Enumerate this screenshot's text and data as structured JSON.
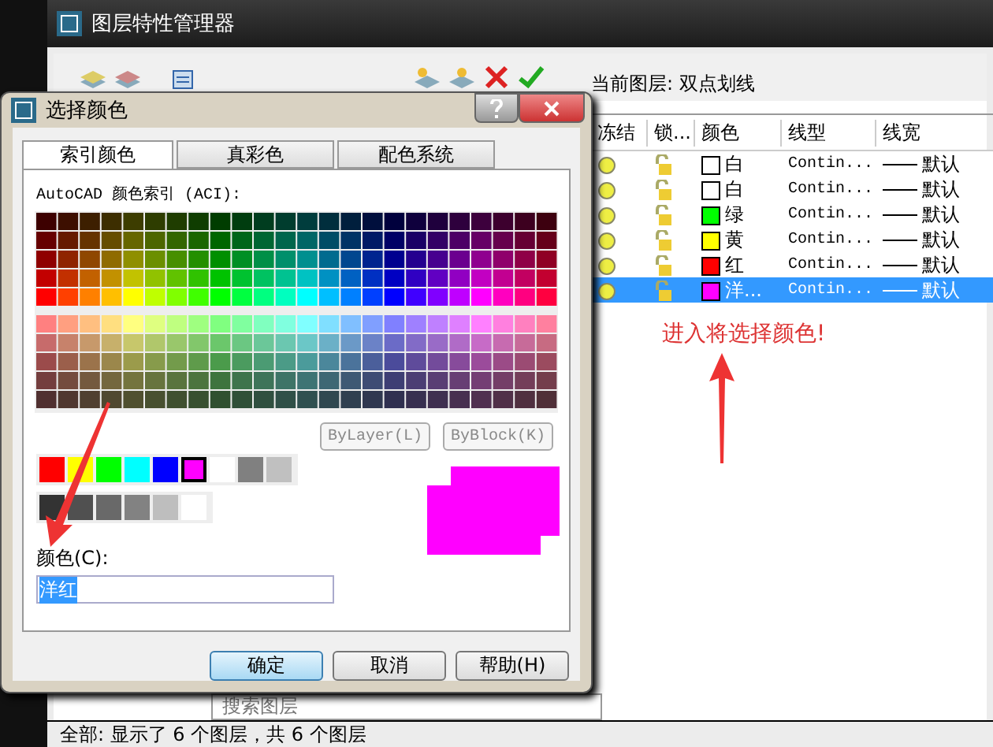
{
  "layer_manager": {
    "title": "图层特性管理器",
    "current_layer": "当前图层: 双点划线",
    "columns": [
      "冻结",
      "锁...",
      "颜色",
      "线型",
      "线宽"
    ],
    "rows": [
      {
        "color_name": "白",
        "color": "#ffffff",
        "linetype": "Contin...",
        "lineweight": "默认",
        "selected": false
      },
      {
        "color_name": "白",
        "color": "#ffffff",
        "linetype": "Contin...",
        "lineweight": "默认",
        "selected": false
      },
      {
        "color_name": "绿",
        "color": "#00ff00",
        "linetype": "Contin...",
        "lineweight": "默认",
        "selected": false
      },
      {
        "color_name": "黄",
        "color": "#ffff00",
        "linetype": "Contin...",
        "lineweight": "默认",
        "selected": false
      },
      {
        "color_name": "红",
        "color": "#ff0000",
        "linetype": "Contin...",
        "lineweight": "默认",
        "selected": false
      },
      {
        "color_name": "洋...",
        "color": "#ff00ff",
        "linetype": "Contin...",
        "lineweight": "默认",
        "selected": true
      }
    ],
    "search_placeholder": "搜索图层",
    "status": "全部: 显示了 6 个图层，共 6 个图层"
  },
  "dialog": {
    "title": "选择颜色",
    "tabs": [
      {
        "label": "索引颜色",
        "selected": true
      },
      {
        "label": "真彩色",
        "selected": false
      },
      {
        "label": "配色系统",
        "selected": false
      }
    ],
    "palette_label": "AutoCAD 颜色索引 (ACI):",
    "standard_colors": [
      {
        "color": "#ff0000",
        "selected": false
      },
      {
        "color": "#ffff00",
        "selected": false
      },
      {
        "color": "#00ff00",
        "selected": false
      },
      {
        "color": "#00ffff",
        "selected": false
      },
      {
        "color": "#0000ff",
        "selected": false
      },
      {
        "color": "#ff00ff",
        "selected": true
      },
      {
        "color": "#ffffff",
        "selected": false
      },
      {
        "color": "#808080",
        "selected": false
      },
      {
        "color": "#c0c0c0",
        "selected": false
      }
    ],
    "gray_colors": [
      {
        "color": "#333333",
        "selected": false
      },
      {
        "color": "#505050",
        "selected": false
      },
      {
        "color": "#696969",
        "selected": false
      },
      {
        "color": "#828282",
        "selected": false
      },
      {
        "color": "#bebebe",
        "selected": false
      },
      {
        "color": "#ffffff",
        "selected": false
      }
    ],
    "bylayer_button": "ByLayer(L)",
    "byblock_button": "ByBlock(K)",
    "color_label": "颜色(C):",
    "color_value": "洋红",
    "buttons": [
      "确定",
      "取消",
      "帮助(H)"
    ]
  },
  "annotation": "进入将选择颜色!"
}
